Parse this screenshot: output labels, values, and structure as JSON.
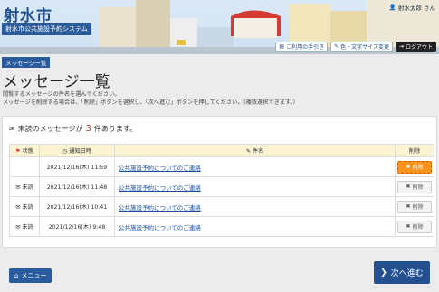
{
  "header": {
    "city_name": "射水市",
    "system_name": "射水市公共施設予約システム",
    "user_name": "射水太郎 さん",
    "links": [
      "ご利用の手引き",
      "色・文字サイズ変更",
      "ログアウト"
    ]
  },
  "breadcrumb": "メッセージ一覧",
  "page_title": "メッセージ一覧",
  "instructions": [
    "閲覧するメッセージの件名を選んでください。",
    "メッセージを削除する場合は、「削除」ボタンを選択し、「次へ進む」ボタンを押してください。（複数選択できます。）"
  ],
  "unread": {
    "prefix": "未読のメッセージが",
    "count": "3",
    "suffix": "件あります。"
  },
  "table": {
    "headers": {
      "status": "状態",
      "date": "通知日時",
      "subject": "件名",
      "delete": "削除"
    },
    "rows": [
      {
        "status": "",
        "date": "2021/12/16(木) 11:59",
        "subject": "公共施設予約についてのご連絡",
        "delete": "削除"
      },
      {
        "status": "未読",
        "date": "2021/12/16(木) 11:48",
        "subject": "公共施設予約についてのご連絡",
        "delete": "削除"
      },
      {
        "status": "未読",
        "date": "2021/12/16(木) 10:41",
        "subject": "公共施設予約についてのご連絡",
        "delete": "削除"
      },
      {
        "status": "未読",
        "date": "2021/12/16(木) 9:48",
        "subject": "公共施設予約についてのご連絡",
        "delete": "削除"
      }
    ]
  },
  "footer": {
    "menu_label": "メニュー",
    "next_label": "次へ進む"
  }
}
